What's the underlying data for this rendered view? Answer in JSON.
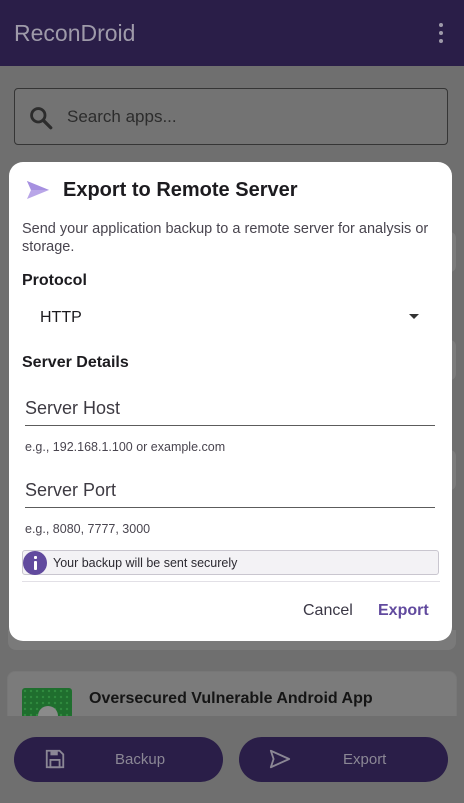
{
  "app": {
    "title": "ReconDroid",
    "search_placeholder": "Search apps..."
  },
  "app_list": {
    "visible_item": "Oversecured Vulnerable Android App"
  },
  "bottom_bar": {
    "backup_label": "Backup",
    "export_label": "Export"
  },
  "dialog": {
    "title": "Export to Remote Server",
    "description": "Send your application backup to a remote server for analysis or storage.",
    "protocol_label": "Protocol",
    "protocol_value": "HTTP",
    "server_details_label": "Server Details",
    "host_placeholder": "Server Host",
    "host_hint": "e.g., 192.168.1.100 or example.com",
    "port_placeholder": "Server Port",
    "port_hint": "e.g., 8080, 7777, 3000",
    "secure_note": "Your backup will be sent securely",
    "cancel_label": "Cancel",
    "export_label": "Export"
  },
  "colors": {
    "app_bar": "#2a1e48",
    "accent": "#614a9e",
    "scrim": "#6f6f6f",
    "dialog_bg": "#ffffff"
  },
  "icons": {
    "overflow": "more-vert-icon",
    "search": "search-icon",
    "dialog": "send-icon",
    "info": "info-icon",
    "backup": "save-icon",
    "export": "send-icon"
  }
}
